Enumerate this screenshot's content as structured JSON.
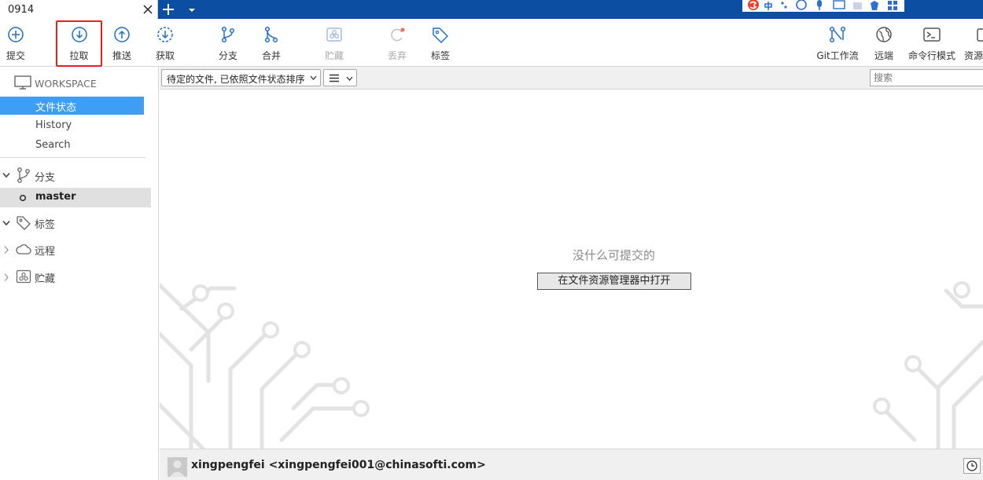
{
  "tab": {
    "title": "0914"
  },
  "toolbar": {
    "commit": "提交",
    "pull": "拉取",
    "push": "推送",
    "fetch": "获取",
    "branch": "分支",
    "merge": "合并",
    "stash": "贮藏",
    "discard": "丢弃",
    "tag": "标签",
    "git_flow": "Git工作流",
    "remote": "远端",
    "terminal": "命令行模式",
    "explorer": "资源"
  },
  "sidebar": {
    "workspace": "WORKSPACE",
    "items": [
      "文件状态",
      "History",
      "Search"
    ],
    "branches": "分支",
    "current_branch": "master",
    "tags": "标签",
    "remotes": "远程",
    "stashes": "贮藏"
  },
  "filter": {
    "sort_label": "待定的文件, 已依照文件状态排序",
    "view_icon": "list-icon",
    "search_placeholder": "搜索"
  },
  "main": {
    "empty_message": "没什么可提交的",
    "open_button": "在文件资源管理器中打开"
  },
  "status": {
    "user": "xingpengfei <xingpengfei001@chinasofti.com>"
  },
  "colors": {
    "tab_bar": "#0b4ea2",
    "selection": "#3d9ef3",
    "icon_blue": "#1f6fc5",
    "highlight": "#e62020"
  }
}
